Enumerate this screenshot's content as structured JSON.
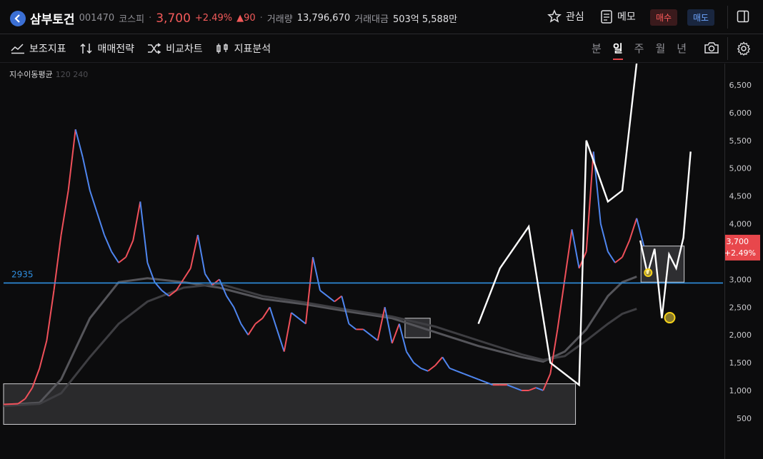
{
  "header": {
    "stock_name": "삼부토건",
    "stock_code": "001470",
    "market": "코스피",
    "price": "3,700",
    "change_pct": "+2.49%",
    "change_abs": "▲90",
    "volume_label": "거래량",
    "volume_value": "13,796,670",
    "amount_label": "거래대금",
    "amount_value": "503억 5,588만",
    "watch_label": "관심",
    "memo_label": "메모",
    "buy_label": "매수",
    "sell_label": "매도"
  },
  "toolbar": {
    "items": [
      {
        "label": "보조지표",
        "icon": "indicator-icon"
      },
      {
        "label": "매매전략",
        "icon": "strategy-icon"
      },
      {
        "label": "비교차트",
        "icon": "compare-icon"
      },
      {
        "label": "지표분석",
        "icon": "analysis-icon"
      }
    ],
    "periods": [
      "분",
      "일",
      "주",
      "월",
      "년"
    ],
    "active_period": "일"
  },
  "legend": {
    "label": "지수이동평균",
    "params": "120 240"
  },
  "colors": {
    "up": "#f0505a",
    "down": "#4f86f0",
    "ma_a": "#3e3e42",
    "ma_b": "#55555a",
    "hline": "#2f8fe0",
    "price_tag": "#e8474c"
  },
  "chart_data": {
    "type": "line",
    "title": "",
    "y_ticks": [
      500,
      1000,
      1500,
      2000,
      2500,
      3000,
      3500,
      4000,
      4500,
      5000,
      5500,
      6000,
      6500
    ],
    "ylim": [
      0,
      6900
    ],
    "xlim": [
      0,
      100
    ],
    "horizontal_line": {
      "label": "2935",
      "value": 2935
    },
    "current_price": {
      "label": "3,700",
      "change": "+2.49%",
      "value": 3700
    },
    "series": [
      {
        "role": "price",
        "x": [
          0,
          2,
          3,
          4,
          5,
          6,
          7,
          8,
          9,
          10,
          11,
          12,
          13,
          14,
          15,
          16,
          17,
          18,
          19,
          20,
          21,
          22,
          23,
          24,
          25,
          26,
          27,
          28,
          29,
          30,
          31,
          32,
          33,
          34,
          35,
          36,
          37,
          38,
          39,
          40,
          41,
          42,
          43,
          44,
          45,
          46,
          47,
          48,
          49,
          50,
          51,
          52,
          53,
          54,
          55,
          56,
          57,
          58,
          59,
          60,
          61,
          62,
          63,
          64,
          65,
          66,
          67,
          68,
          69,
          70,
          71,
          72,
          73,
          74,
          75,
          76,
          77,
          78,
          79,
          80,
          81,
          82,
          83,
          84,
          85,
          86,
          87,
          88,
          89
        ],
        "y": [
          750,
          760,
          850,
          1050,
          1400,
          1900,
          2800,
          3800,
          4600,
          5700,
          5200,
          4600,
          4200,
          3800,
          3500,
          3300,
          3400,
          3700,
          4400,
          3300,
          2950,
          2800,
          2700,
          2800,
          3000,
          3200,
          3800,
          3100,
          2900,
          3000,
          2700,
          2500,
          2200,
          2000,
          2200,
          2300,
          2500,
          2100,
          1700,
          2400,
          2300,
          2200,
          3400,
          2800,
          2700,
          2600,
          2700,
          2200,
          2100,
          2100,
          2000,
          1900,
          2500,
          1850,
          2200,
          1700,
          1500,
          1400,
          1350,
          1450,
          1600,
          1400,
          1350,
          1300,
          1250,
          1200,
          1150,
          1100,
          1100,
          1100,
          1050,
          1000,
          1000,
          1050,
          1000,
          1300,
          2100,
          3000,
          3900,
          3200,
          3500,
          5300,
          4000,
          3500,
          3300,
          3400,
          3700,
          4100,
          3600
        ]
      },
      {
        "role": "ema120",
        "x": [
          0,
          5,
          8,
          12,
          16,
          20,
          25,
          30,
          36,
          42,
          48,
          54,
          60,
          66,
          72,
          75,
          78,
          81,
          84,
          86,
          88
        ],
        "y": [
          740,
          780,
          1200,
          2300,
          2950,
          3020,
          2950,
          2850,
          2650,
          2550,
          2420,
          2300,
          2050,
          1800,
          1600,
          1520,
          1700,
          2100,
          2700,
          2950,
          3050
        ]
      },
      {
        "role": "ema240",
        "x": [
          0,
          5,
          8,
          12,
          16,
          20,
          25,
          30,
          36,
          42,
          48,
          54,
          60,
          66,
          72,
          75,
          78,
          81,
          84,
          86,
          88
        ],
        "y": [
          720,
          760,
          950,
          1600,
          2200,
          2600,
          2850,
          2920,
          2700,
          2580,
          2450,
          2330,
          2150,
          1900,
          1650,
          1550,
          1620,
          1900,
          2200,
          2380,
          2470
        ]
      }
    ],
    "annotations": {
      "white_path": {
        "x": [
          66,
          69,
          73,
          76,
          80,
          81,
          84,
          86,
          88
        ],
        "y": [
          2200,
          3200,
          3950,
          1500,
          1100,
          5500,
          4400,
          4600,
          6900
        ]
      },
      "projection_path": {
        "x": [
          88.5,
          89.5,
          90.5,
          91.5,
          92.5,
          93.5,
          94.5,
          95.5
        ],
        "y": [
          3700,
          3100,
          3550,
          2300,
          3450,
          3200,
          3750,
          5300
        ]
      },
      "circles": [
        {
          "x": 89.6,
          "y": 3120
        },
        {
          "x": 92.6,
          "y": 2310
        }
      ],
      "boxes": [
        {
          "x0": 0,
          "x1": 79.5,
          "y0": 390,
          "y1": 1120
        },
        {
          "x0": 55.8,
          "x1": 59.3,
          "y0": 1950,
          "y1": 2300
        },
        {
          "x0": 88.6,
          "x1": 94.6,
          "y0": 2950,
          "y1": 3600
        }
      ]
    }
  }
}
